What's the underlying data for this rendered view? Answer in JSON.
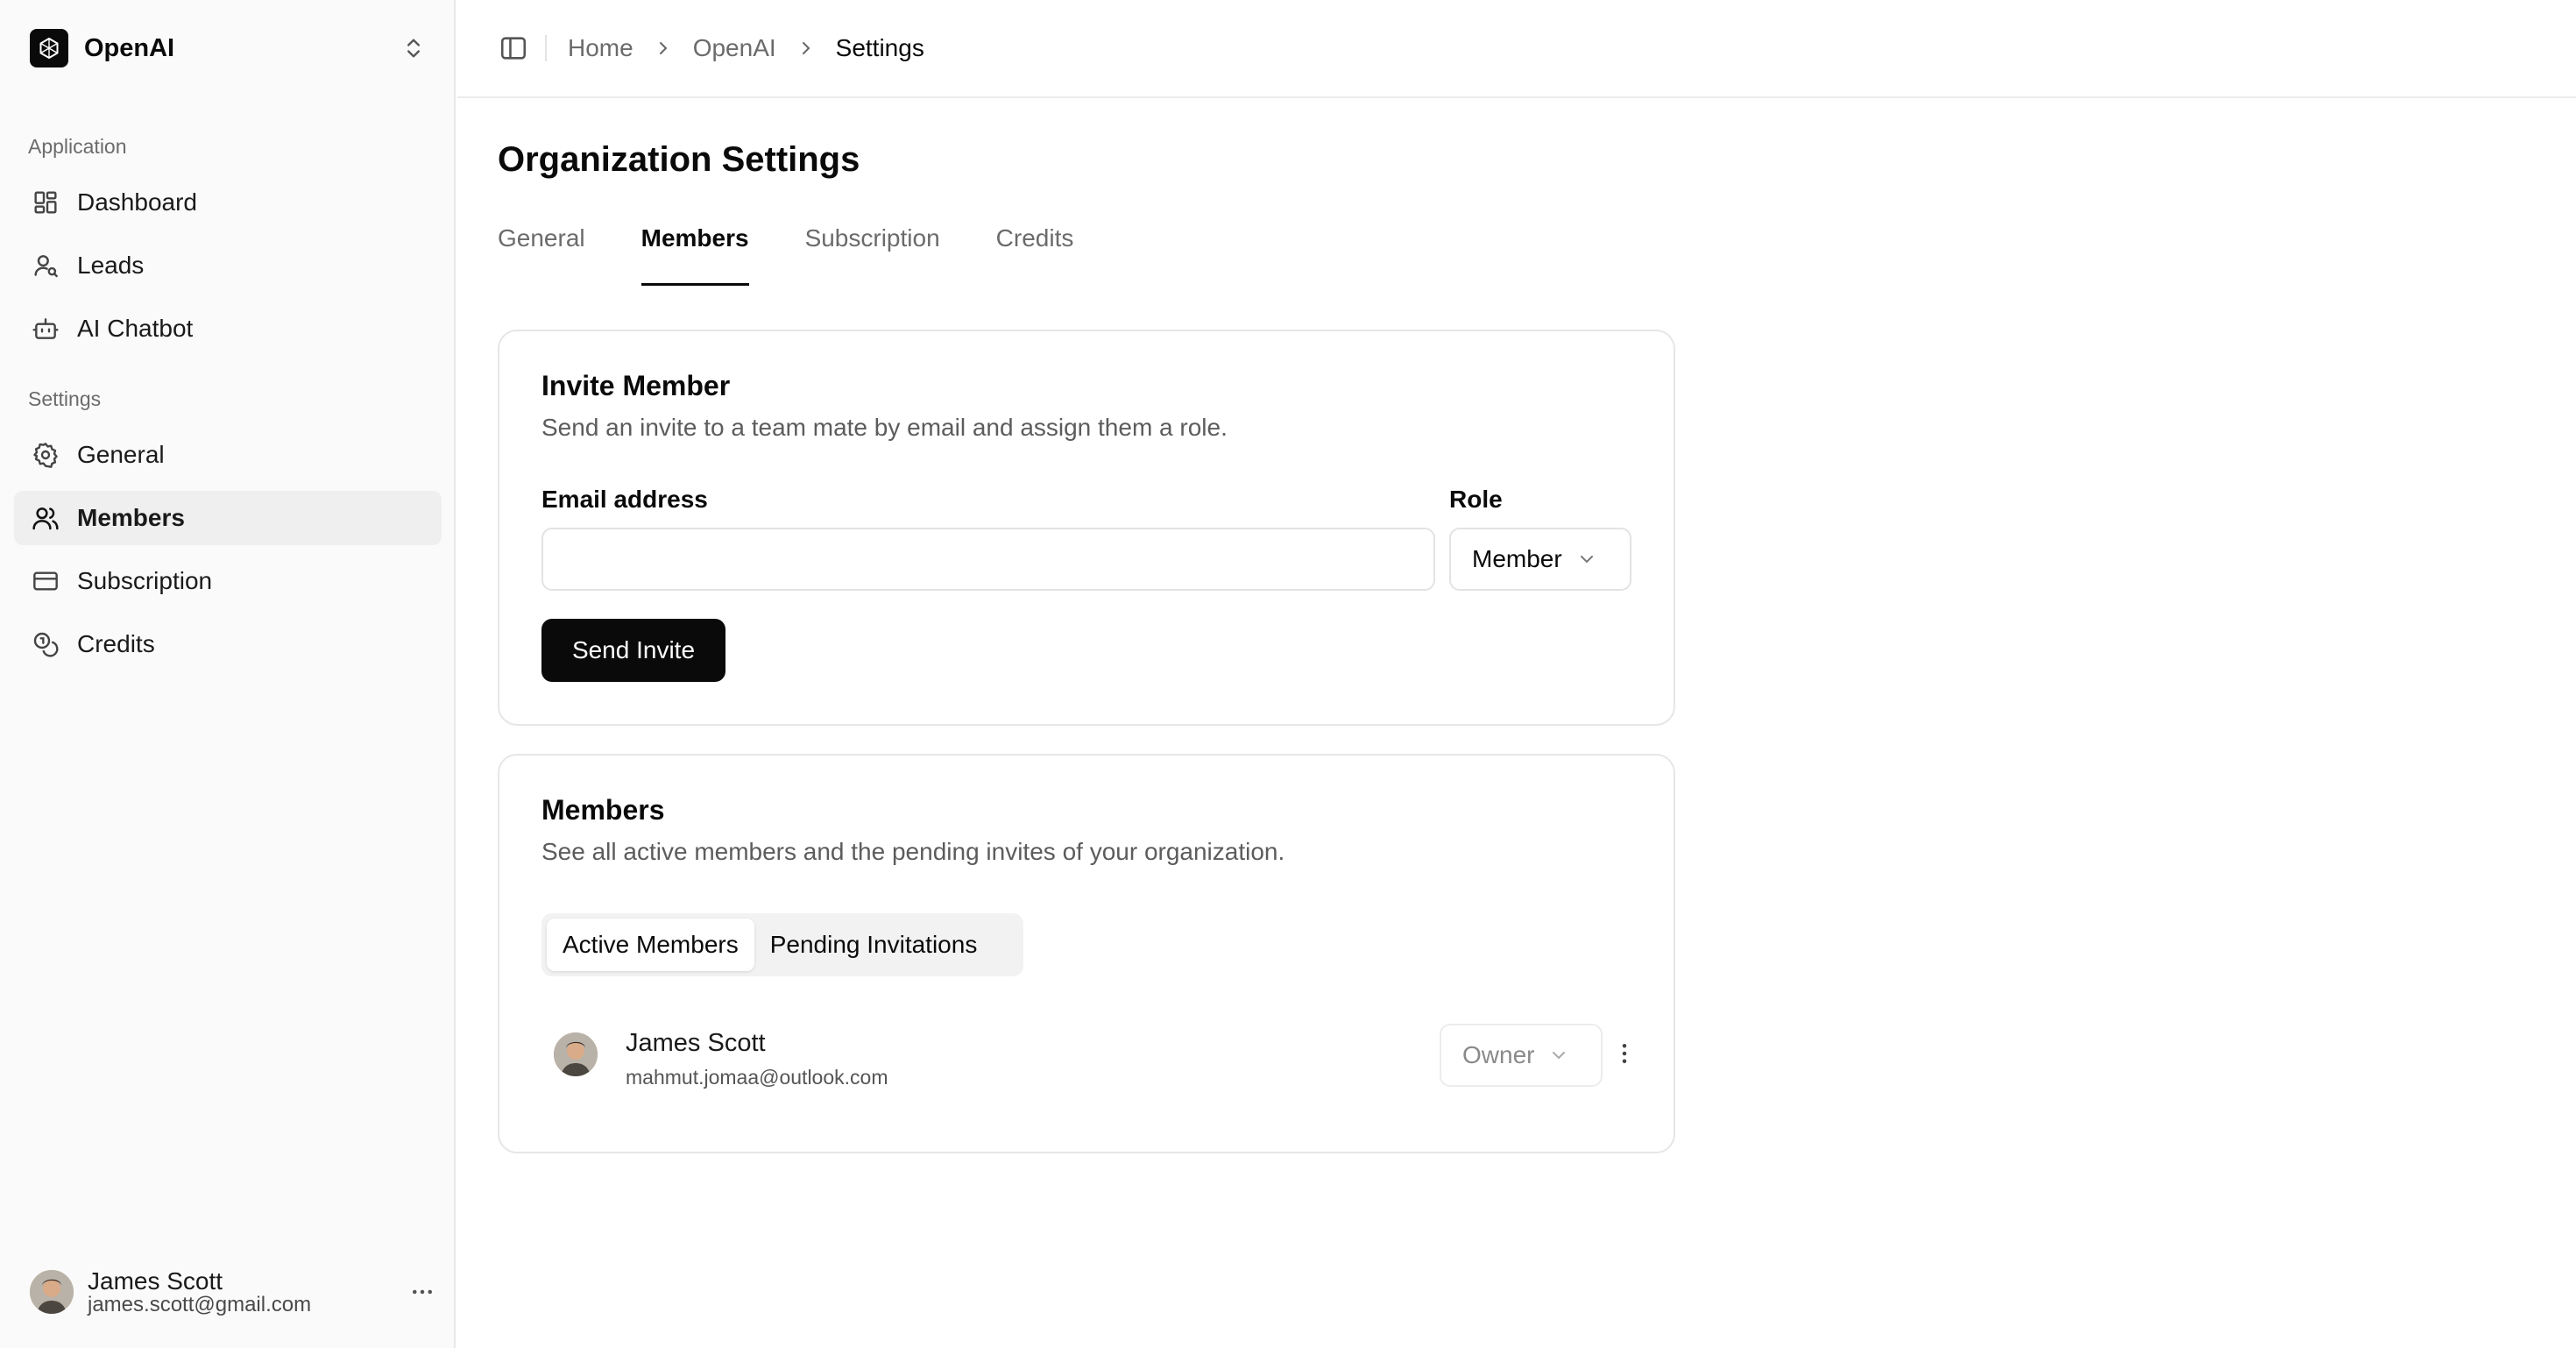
{
  "org": {
    "name": "OpenAI"
  },
  "sidebar": {
    "groups": [
      {
        "label": "Application"
      },
      {
        "label": "Settings"
      }
    ],
    "items": [
      {
        "label": "Dashboard",
        "icon": "dashboard-icon"
      },
      {
        "label": "Leads",
        "icon": "user-search-icon"
      },
      {
        "label": "AI Chatbot",
        "icon": "bot-icon"
      },
      {
        "label": "General",
        "icon": "gear-icon"
      },
      {
        "label": "Members",
        "icon": "users-icon",
        "active": true
      },
      {
        "label": "Subscription",
        "icon": "credit-card-icon"
      },
      {
        "label": "Credits",
        "icon": "coins-icon"
      }
    ],
    "user": {
      "name": "James Scott",
      "email": "james.scott@gmail.com"
    }
  },
  "breadcrumb": {
    "items": [
      "Home",
      "OpenAI",
      "Settings"
    ]
  },
  "page": {
    "title": "Organization Settings",
    "tabs": [
      "General",
      "Members",
      "Subscription",
      "Credits"
    ],
    "active_tab": "Members"
  },
  "invite": {
    "title": "Invite Member",
    "description": "Send an invite to a team mate by email and assign them a role.",
    "email_label": "Email address",
    "email_value": "",
    "role_label": "Role",
    "role_value": "Member",
    "button": "Send Invite"
  },
  "members": {
    "title": "Members",
    "description": "See all active members and the pending invites of your organization.",
    "tabs": [
      "Active Members",
      "Pending Invitations"
    ],
    "active_tab": "Active Members",
    "rows": [
      {
        "name": "James Scott",
        "email": "mahmut.jomaa@outlook.com",
        "role": "Owner"
      }
    ]
  },
  "colors": {
    "primary": "#0a0a0a",
    "sidebar_bg": "#fafafa",
    "muted_text": "#6b6b6b",
    "border": "#e6e6e6"
  }
}
